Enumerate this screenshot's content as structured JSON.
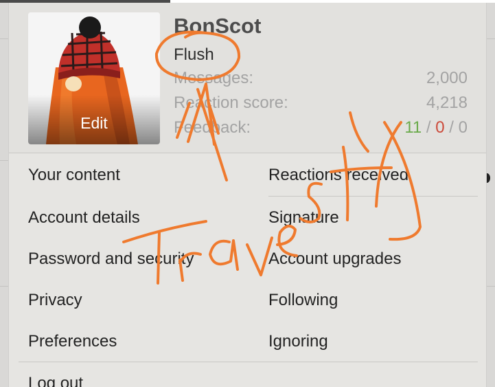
{
  "user": {
    "username": "BonScot",
    "title": "Flush",
    "avatar_action": "Edit"
  },
  "stats": [
    {
      "label": "Messages:",
      "value": "2,000"
    },
    {
      "label": "Reaction score:",
      "value": "4,218"
    }
  ],
  "feedback": {
    "label": "Feedback:",
    "positive": "11",
    "negative": "0",
    "neutral": "0",
    "separator": "/"
  },
  "menu": {
    "left": [
      "Your content",
      "Account details",
      "Password and security",
      "Privacy",
      "Preferences"
    ],
    "right": [
      "Reactions received",
      "Signature",
      "Account upgrades",
      "Following",
      "Ignoring"
    ],
    "logout": "Log out"
  },
  "colors": {
    "feedback_positive": "#6aaa4a",
    "feedback_negative": "#cc4a3a",
    "annotation": "#ef7a2e"
  },
  "icons": [
    "avatar-image"
  ]
}
